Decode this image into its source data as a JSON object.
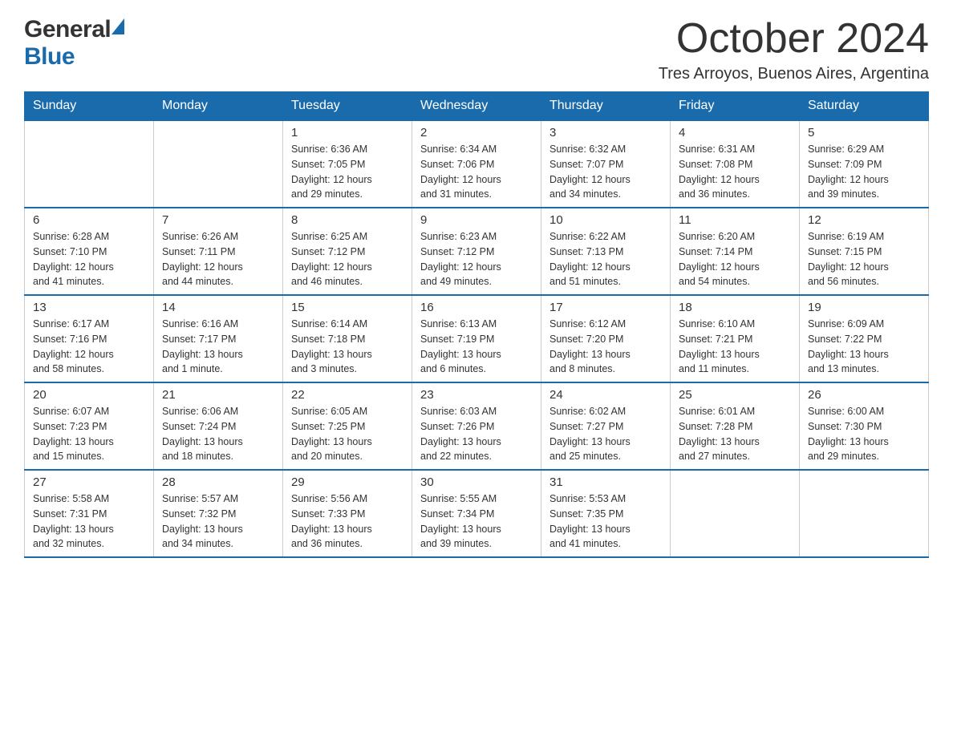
{
  "header": {
    "title": "October 2024",
    "subtitle": "Tres Arroyos, Buenos Aires, Argentina",
    "logo_general": "General",
    "logo_blue": "Blue"
  },
  "calendar": {
    "days_of_week": [
      "Sunday",
      "Monday",
      "Tuesday",
      "Wednesday",
      "Thursday",
      "Friday",
      "Saturday"
    ],
    "weeks": [
      [
        {
          "day": "",
          "info": ""
        },
        {
          "day": "",
          "info": ""
        },
        {
          "day": "1",
          "info": "Sunrise: 6:36 AM\nSunset: 7:05 PM\nDaylight: 12 hours\nand 29 minutes."
        },
        {
          "day": "2",
          "info": "Sunrise: 6:34 AM\nSunset: 7:06 PM\nDaylight: 12 hours\nand 31 minutes."
        },
        {
          "day": "3",
          "info": "Sunrise: 6:32 AM\nSunset: 7:07 PM\nDaylight: 12 hours\nand 34 minutes."
        },
        {
          "day": "4",
          "info": "Sunrise: 6:31 AM\nSunset: 7:08 PM\nDaylight: 12 hours\nand 36 minutes."
        },
        {
          "day": "5",
          "info": "Sunrise: 6:29 AM\nSunset: 7:09 PM\nDaylight: 12 hours\nand 39 minutes."
        }
      ],
      [
        {
          "day": "6",
          "info": "Sunrise: 6:28 AM\nSunset: 7:10 PM\nDaylight: 12 hours\nand 41 minutes."
        },
        {
          "day": "7",
          "info": "Sunrise: 6:26 AM\nSunset: 7:11 PM\nDaylight: 12 hours\nand 44 minutes."
        },
        {
          "day": "8",
          "info": "Sunrise: 6:25 AM\nSunset: 7:12 PM\nDaylight: 12 hours\nand 46 minutes."
        },
        {
          "day": "9",
          "info": "Sunrise: 6:23 AM\nSunset: 7:12 PM\nDaylight: 12 hours\nand 49 minutes."
        },
        {
          "day": "10",
          "info": "Sunrise: 6:22 AM\nSunset: 7:13 PM\nDaylight: 12 hours\nand 51 minutes."
        },
        {
          "day": "11",
          "info": "Sunrise: 6:20 AM\nSunset: 7:14 PM\nDaylight: 12 hours\nand 54 minutes."
        },
        {
          "day": "12",
          "info": "Sunrise: 6:19 AM\nSunset: 7:15 PM\nDaylight: 12 hours\nand 56 minutes."
        }
      ],
      [
        {
          "day": "13",
          "info": "Sunrise: 6:17 AM\nSunset: 7:16 PM\nDaylight: 12 hours\nand 58 minutes."
        },
        {
          "day": "14",
          "info": "Sunrise: 6:16 AM\nSunset: 7:17 PM\nDaylight: 13 hours\nand 1 minute."
        },
        {
          "day": "15",
          "info": "Sunrise: 6:14 AM\nSunset: 7:18 PM\nDaylight: 13 hours\nand 3 minutes."
        },
        {
          "day": "16",
          "info": "Sunrise: 6:13 AM\nSunset: 7:19 PM\nDaylight: 13 hours\nand 6 minutes."
        },
        {
          "day": "17",
          "info": "Sunrise: 6:12 AM\nSunset: 7:20 PM\nDaylight: 13 hours\nand 8 minutes."
        },
        {
          "day": "18",
          "info": "Sunrise: 6:10 AM\nSunset: 7:21 PM\nDaylight: 13 hours\nand 11 minutes."
        },
        {
          "day": "19",
          "info": "Sunrise: 6:09 AM\nSunset: 7:22 PM\nDaylight: 13 hours\nand 13 minutes."
        }
      ],
      [
        {
          "day": "20",
          "info": "Sunrise: 6:07 AM\nSunset: 7:23 PM\nDaylight: 13 hours\nand 15 minutes."
        },
        {
          "day": "21",
          "info": "Sunrise: 6:06 AM\nSunset: 7:24 PM\nDaylight: 13 hours\nand 18 minutes."
        },
        {
          "day": "22",
          "info": "Sunrise: 6:05 AM\nSunset: 7:25 PM\nDaylight: 13 hours\nand 20 minutes."
        },
        {
          "day": "23",
          "info": "Sunrise: 6:03 AM\nSunset: 7:26 PM\nDaylight: 13 hours\nand 22 minutes."
        },
        {
          "day": "24",
          "info": "Sunrise: 6:02 AM\nSunset: 7:27 PM\nDaylight: 13 hours\nand 25 minutes."
        },
        {
          "day": "25",
          "info": "Sunrise: 6:01 AM\nSunset: 7:28 PM\nDaylight: 13 hours\nand 27 minutes."
        },
        {
          "day": "26",
          "info": "Sunrise: 6:00 AM\nSunset: 7:30 PM\nDaylight: 13 hours\nand 29 minutes."
        }
      ],
      [
        {
          "day": "27",
          "info": "Sunrise: 5:58 AM\nSunset: 7:31 PM\nDaylight: 13 hours\nand 32 minutes."
        },
        {
          "day": "28",
          "info": "Sunrise: 5:57 AM\nSunset: 7:32 PM\nDaylight: 13 hours\nand 34 minutes."
        },
        {
          "day": "29",
          "info": "Sunrise: 5:56 AM\nSunset: 7:33 PM\nDaylight: 13 hours\nand 36 minutes."
        },
        {
          "day": "30",
          "info": "Sunrise: 5:55 AM\nSunset: 7:34 PM\nDaylight: 13 hours\nand 39 minutes."
        },
        {
          "day": "31",
          "info": "Sunrise: 5:53 AM\nSunset: 7:35 PM\nDaylight: 13 hours\nand 41 minutes."
        },
        {
          "day": "",
          "info": ""
        },
        {
          "day": "",
          "info": ""
        }
      ]
    ]
  }
}
